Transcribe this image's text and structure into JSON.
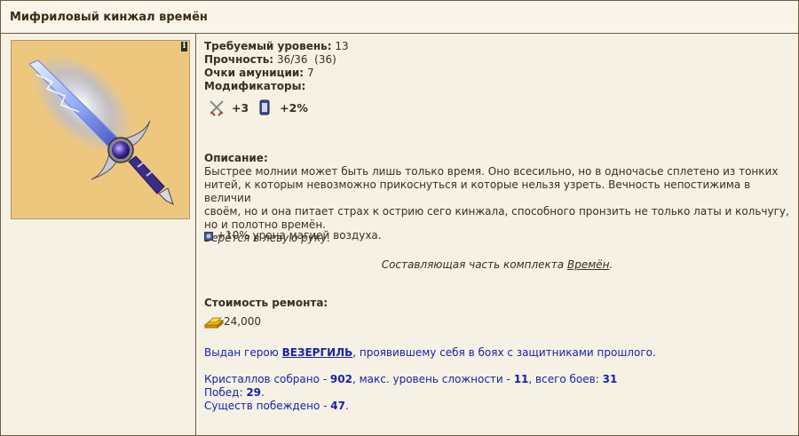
{
  "title": "Мифриловый кинжал времён",
  "info_icon": "i",
  "stats": {
    "level_label": "Требуемый уровень:",
    "level_value": "13",
    "durability_label": "Прочность:",
    "durability_value": "36/36",
    "durability_max": "(36)",
    "ammo_label": "Очки амуниции:",
    "ammo_value": "7",
    "modifiers_label": "Модификаторы:"
  },
  "modifiers": [
    {
      "icon": "crossed-swords-icon",
      "value": "+3"
    },
    {
      "icon": "scroll-icon",
      "value": "+2%"
    }
  ],
  "description": {
    "label": "Описание:",
    "lines": [
      "Быстрее молнии может быть лишь только время. Оно всесильно, но в одночасье сплетено из тонких",
      "нитей, к которым невозможно прикоснуться и которые нельзя узреть. Вечность непостижима в величии",
      "своём, но и она питает страх к острию сего кинжала, способного пронзить не только латы и кольчугу,",
      "но и полотно времён."
    ],
    "hand": "Берётся в левую руку."
  },
  "bonus": {
    "icon": "air-magic-icon",
    "text": "+10% урона магией воздуха."
  },
  "set": {
    "prefix": "Составляющая часть комплекта ",
    "link": "Времён",
    "suffix": "."
  },
  "repair": {
    "label": "Стоимость ремонта:",
    "icon": "gold-icon",
    "value": "24,000"
  },
  "hero": {
    "prefix": "Выдан герою ",
    "name": "ВЕЗЕРГИЛЬ",
    "suffix": ", проявившему себя в боях с защитниками прошлого."
  },
  "records": {
    "crystals_label": "Кристаллов собрано - ",
    "crystals_value": "902",
    "difficulty_label": ", макс. уровень сложности - ",
    "difficulty_value": "11",
    "battles_label": ", всего боев: ",
    "battles_value": "31",
    "wins_label": "Побед: ",
    "wins_value": "29",
    "wins_suffix": ".",
    "creatures_label": "Существ побеждено - ",
    "creatures_value": "47",
    "creatures_suffix": "."
  }
}
